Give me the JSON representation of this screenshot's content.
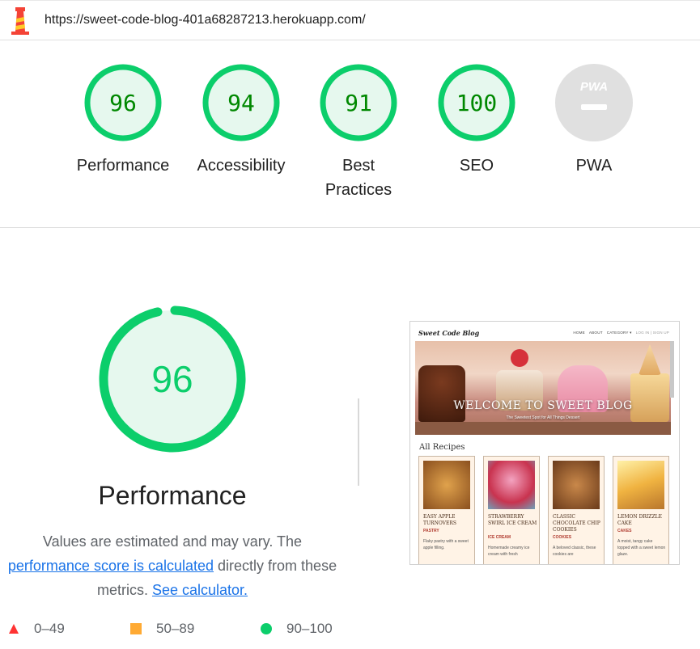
{
  "header": {
    "url": "https://sweet-code-blog-401a68287213.herokuapp.com/",
    "logo_icon": "lighthouse-icon"
  },
  "gauges": [
    {
      "id": "performance",
      "score": 96,
      "label": "Performance"
    },
    {
      "id": "accessibility",
      "score": 94,
      "label": "Accessibility"
    },
    {
      "id": "best-practices",
      "score": 91,
      "label": "Best Practices"
    },
    {
      "id": "seo",
      "score": 100,
      "label": "SEO"
    },
    {
      "id": "pwa",
      "score": null,
      "label": "PWA",
      "badge": "PWA"
    }
  ],
  "performance": {
    "score": 96,
    "title": "Performance",
    "desc_prefix": "Values are estimated and may vary. The",
    "link1": "performance score is calculated",
    "desc_middle": "directly from these metrics.",
    "link2": "See calculator."
  },
  "legend": [
    {
      "shape": "triangle",
      "range": "0–49",
      "color": "#ff3333"
    },
    {
      "shape": "square",
      "range": "50–89",
      "color": "#ffaa33"
    },
    {
      "shape": "circle",
      "range": "90–100",
      "color": "#0cce6b"
    }
  ],
  "colors": {
    "pass": "#0cce6b",
    "pass_fill": "#e6f8ee",
    "pass_text": "#008800",
    "na": "#e0e0e0"
  },
  "thumbnail": {
    "brand": "Sweet Code Blog",
    "nav": [
      "HOME",
      "ABOUT",
      "CATEGORY ▾",
      "LOG IN | SIGN UP"
    ],
    "hero_title": "WELCOME TO SWEET BLOG",
    "hero_sub": "The Sweetest Spot for All Things Dessert",
    "section": "All Recipes",
    "cards": [
      {
        "name": "EASY APPLE TURNOVERS",
        "category": "PASTRY",
        "blurb": "Flaky pastry with a sweet apple filling."
      },
      {
        "name": "STRAWBERRY SWIRL ICE CREAM",
        "category": "ICE CREAM",
        "blurb": "Homemade creamy ice cream with fresh"
      },
      {
        "name": "CLASSIC CHOCOLATE CHIP COOKIES",
        "category": "COOKIES",
        "blurb": "A beloved classic, these cookies are"
      },
      {
        "name": "LEMON DRIZZLE CAKE",
        "category": "CAKES",
        "blurb": "A moist, tangy cake topped with a sweet lemon glaze."
      }
    ]
  }
}
